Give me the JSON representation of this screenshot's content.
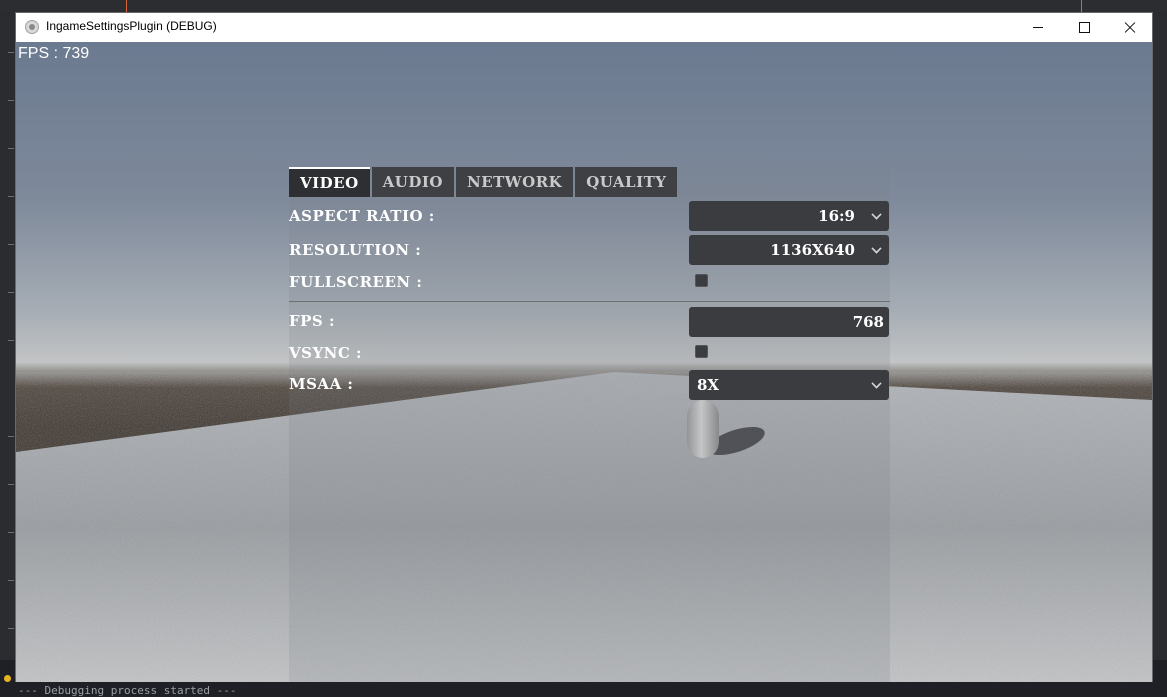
{
  "window": {
    "title": "IngameSettingsPlugin (DEBUG)"
  },
  "background": {
    "console_lines": [
      "",
      "--- Debugging process started ---"
    ]
  },
  "hud": {
    "fps_text": "FPS : 739"
  },
  "tabs": [
    {
      "label": "VIDEO",
      "active": true
    },
    {
      "label": "AUDIO",
      "active": false
    },
    {
      "label": "NETWORK",
      "active": false
    },
    {
      "label": "QUALITY",
      "active": false
    }
  ],
  "video": {
    "aspect_ratio": {
      "label": "ASPECT RATIO :",
      "value": "16:9"
    },
    "resolution": {
      "label": "RESOLUTION :",
      "value": "1136X640"
    },
    "fullscreen": {
      "label": "FULLSCREEN :",
      "checked": false
    },
    "fps": {
      "label": "FPS :",
      "value": "768"
    },
    "vsync": {
      "label": "VSYNC :",
      "checked": false
    },
    "msaa": {
      "label": "MSAA :",
      "value": "8X"
    }
  },
  "colors": {
    "panel_control": "#3b3c40",
    "tab_active": "#2e2f33",
    "tab_inactive": "#3f4043",
    "text": "#ffffff"
  }
}
